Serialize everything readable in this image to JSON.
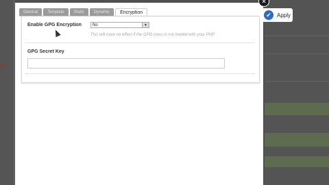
{
  "background": {
    "left_snippet": "ra"
  },
  "apply_button": {
    "label": "Apply"
  },
  "dialog": {
    "tabs": [
      {
        "label": "General",
        "active": false
      },
      {
        "label": "Template",
        "active": false
      },
      {
        "label": "Static",
        "active": false
      },
      {
        "label": "Dynamic",
        "active": false
      },
      {
        "label": "Encryption",
        "active": true
      }
    ],
    "gpg_encryption": {
      "label": "Enable GPG Encryption",
      "selected": "No",
      "hint": "This will have no effect if the GPG class is not loaded with your PHP"
    },
    "gpg_secret_key": {
      "label": "GPG Secret Key",
      "value": ""
    }
  },
  "colors": {
    "overlay": "#4f4f4f",
    "tab_inactive": "#9b9b9b",
    "apply_icon": "#2b6cc4"
  }
}
